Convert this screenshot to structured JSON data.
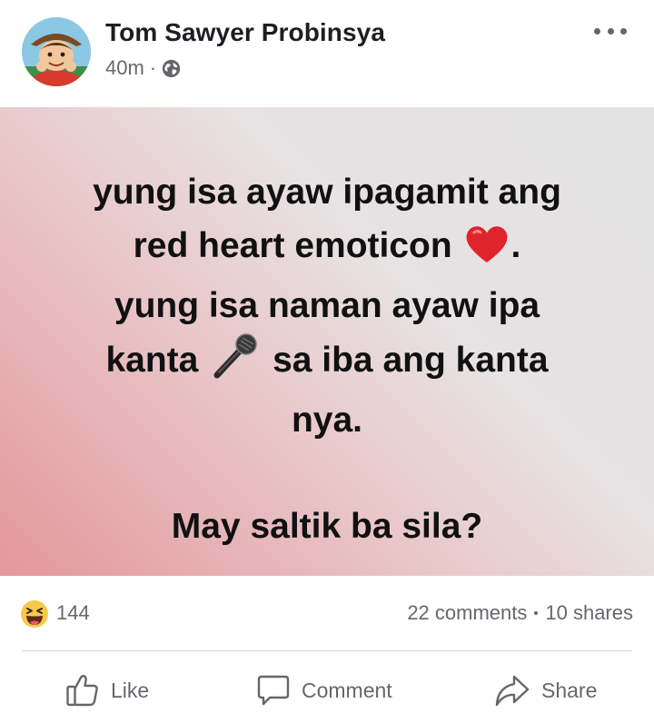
{
  "post": {
    "author": "Tom Sawyer Probinsya",
    "time": "40m",
    "separator": "·",
    "privacy_icon": "globe-icon",
    "more_icon": "more-options-icon"
  },
  "content": {
    "line1": "yung isa ayaw ipagamit ang",
    "line2_before": "red heart emoticon",
    "line2_after": ".",
    "line3": "yung isa naman ayaw ipa",
    "line4_before": "kanta",
    "line4_after": "sa iba ang kanta",
    "line5": "nya.",
    "line6": "May saltik ba sila?",
    "emoji_1": "red-heart-emoji",
    "emoji_2": "microphone-emoji",
    "background_colors": [
      "#e3979c",
      "#e9c6c8",
      "#e3e3e4"
    ]
  },
  "stats": {
    "reaction_icon": "haha-reaction-icon",
    "reaction_count": "144",
    "comments": "22 comments",
    "shares": "10 shares"
  },
  "actions": {
    "like": "Like",
    "comment": "Comment",
    "share": "Share"
  }
}
